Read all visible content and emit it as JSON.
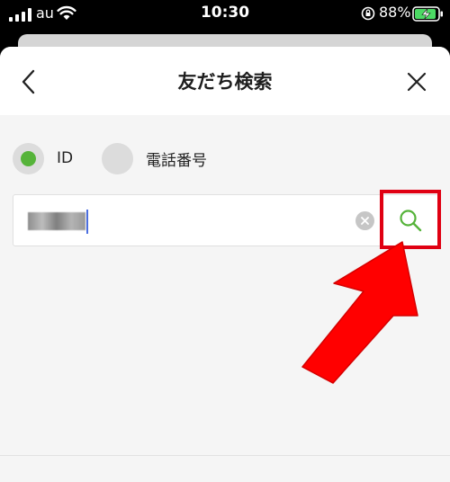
{
  "status_bar": {
    "carrier": "au",
    "time": "10:30",
    "battery_percent": "88%"
  },
  "header": {
    "title": "友だち検索"
  },
  "search_type": {
    "options": [
      {
        "label": "ID",
        "selected": true
      },
      {
        "label": "電話番号",
        "selected": false
      }
    ]
  },
  "search": {
    "value": "",
    "value_redacted": true
  },
  "colors": {
    "accent_green": "#55b339",
    "annotation_red": "#e00012",
    "caret_blue": "#4c6fe0"
  },
  "icons": [
    "signal-icon",
    "wifi-icon",
    "orientation-lock-icon",
    "battery-charging-icon",
    "chevron-left-icon",
    "close-icon",
    "clear-icon",
    "search-icon"
  ]
}
